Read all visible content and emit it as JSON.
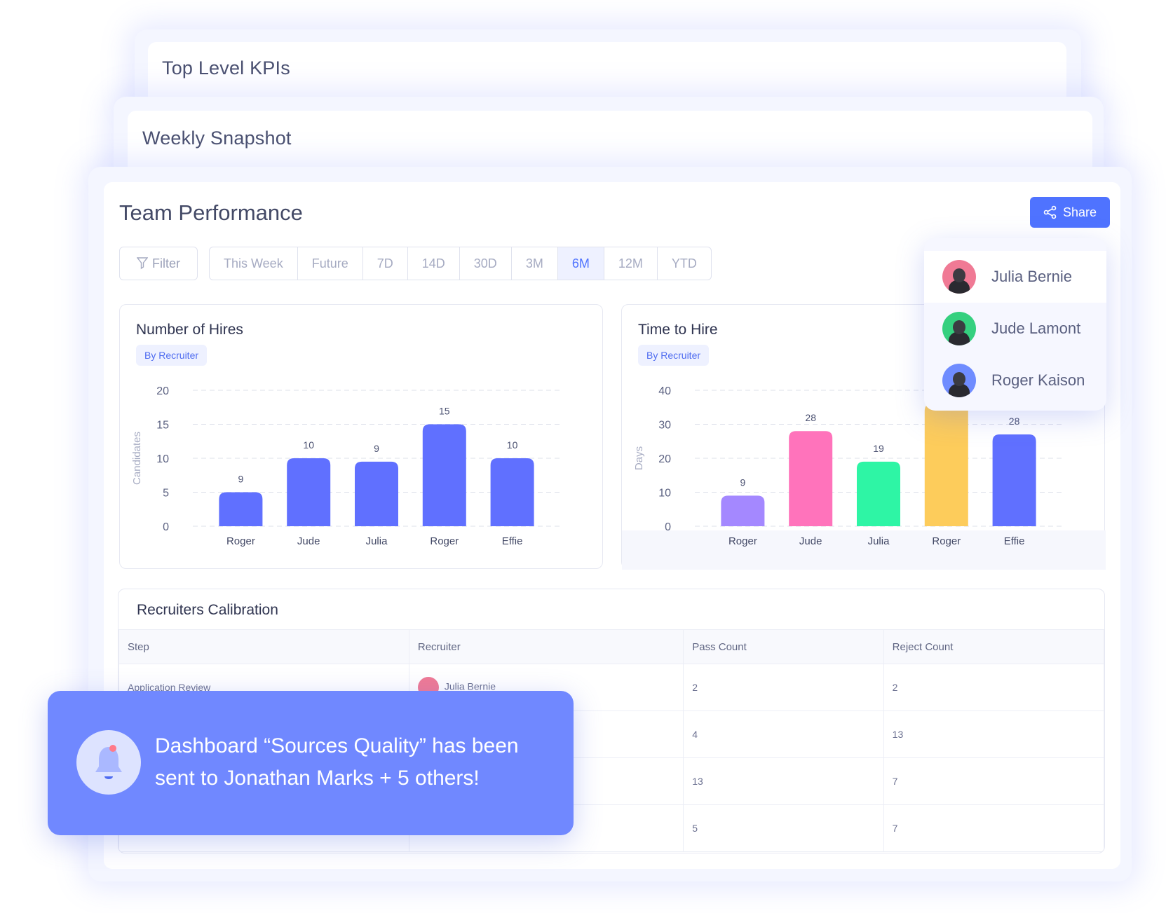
{
  "stack": {
    "back_title": "Top Level KPIs",
    "middle_title": "Weekly Snapshot"
  },
  "main": {
    "title": "Team Performance",
    "share_label": "Share",
    "filter_label": "Filter",
    "range_tabs": [
      {
        "label": "This Week",
        "active": false
      },
      {
        "label": "Future",
        "active": false
      },
      {
        "label": "7D",
        "active": false
      },
      {
        "label": "14D",
        "active": false
      },
      {
        "label": "30D",
        "active": false
      },
      {
        "label": "3M",
        "active": false
      },
      {
        "label": "6M",
        "active": true
      },
      {
        "label": "12M",
        "active": false
      },
      {
        "label": "YTD",
        "active": false
      }
    ]
  },
  "dropdown": {
    "items": [
      {
        "name": "Julia Bernie",
        "avatar_color": "#f07a95"
      },
      {
        "name": "Jude Lamont",
        "avatar_color": "#35d07f"
      },
      {
        "name": "Roger Kaison",
        "avatar_color": "#6f8cff"
      }
    ]
  },
  "chart_data": [
    {
      "type": "bar",
      "title": "Number of Hires",
      "badge": "By Recruiter",
      "xlabel": "",
      "ylabel": "Candidates",
      "ylim": [
        0,
        20
      ],
      "yticks": [
        0,
        5,
        10,
        15,
        20
      ],
      "grid": true,
      "categories": [
        "Roger",
        "Jude",
        "Julia",
        "Roger",
        "Effie"
      ],
      "values": [
        5,
        10,
        9.5,
        15,
        10
      ],
      "data_labels": [
        "9",
        "10",
        "9",
        "15",
        "10"
      ],
      "colors": [
        "#6070ff",
        "#6070ff",
        "#6070ff",
        "#6070ff",
        "#6070ff"
      ]
    },
    {
      "type": "bar",
      "title": "Time to Hire",
      "badge": "By Recruiter",
      "xlabel": "",
      "ylabel": "Days",
      "ylim": [
        0,
        40
      ],
      "yticks": [
        0,
        10,
        20,
        30,
        40
      ],
      "grid": true,
      "categories": [
        "Roger",
        "Jude",
        "Julia",
        "Roger",
        "Effie"
      ],
      "values": [
        9,
        28,
        19,
        36,
        27
      ],
      "data_labels": [
        "9",
        "28",
        "19",
        "",
        "28"
      ],
      "colors": [
        "#a488ff",
        "#ff73bb",
        "#2ef5a5",
        "#fdcc5b",
        "#6070ff"
      ]
    }
  ],
  "calibration": {
    "title": "Recruiters Calibration",
    "columns": [
      "Step",
      "Recruiter",
      "Pass Count",
      "Reject Count"
    ],
    "rows": [
      {
        "step": "Application Review",
        "recruiter": "Julia Bernie",
        "pass": "2",
        "reject": "2"
      },
      {
        "step": "",
        "recruiter": "",
        "pass": "4",
        "reject": "13"
      },
      {
        "step": "",
        "recruiter": "",
        "pass": "13",
        "reject": "7"
      },
      {
        "step": "",
        "recruiter": "",
        "pass": "5",
        "reject": "7"
      }
    ]
  },
  "toast": {
    "message": "Dashboard “Sources Quality” has been sent to Jonathan Marks + 5 others!",
    "icon": "bell-icon"
  }
}
